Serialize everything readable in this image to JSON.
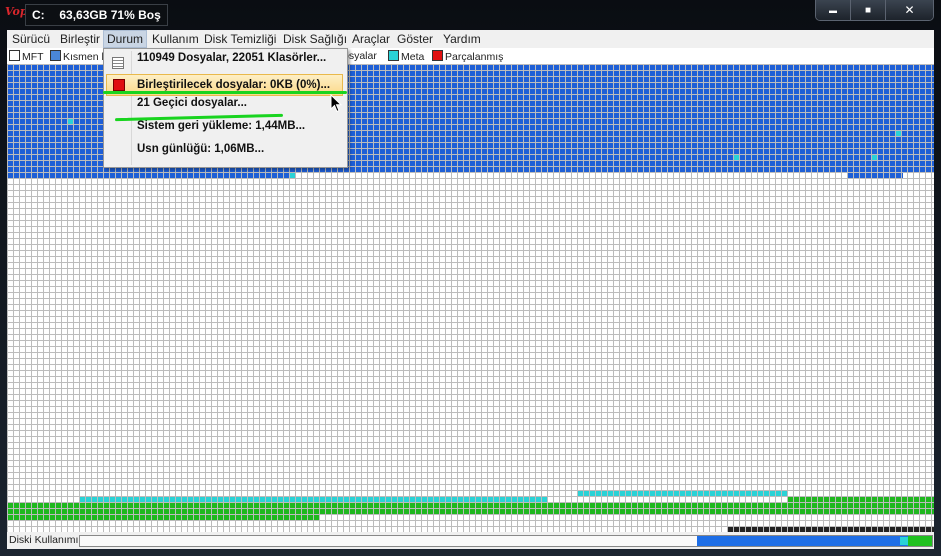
{
  "titlebar": {
    "logo": "Vopt",
    "drive": "C:",
    "summary": "63,63GB 71% Boş"
  },
  "window_controls": {
    "minimize": "▬",
    "maximize": "■",
    "close": "✕"
  },
  "menu": [
    "Sürücü",
    "Birleştir",
    "Durum",
    "Kullanım",
    "Disk Temizliği",
    "Disk Sağlığı",
    "Araçlar",
    "Göster",
    "Yardım"
  ],
  "legend": [
    {
      "label": "MFT",
      "color": "#ffffff"
    },
    {
      "label": "Kısmen b",
      "color": "#4a86d8"
    },
    {
      "label": "osyalar",
      "color": ""
    },
    {
      "label": "Meta",
      "color": "#2ad2d6"
    },
    {
      "label": "Parçalanmış",
      "color": "#e01010"
    }
  ],
  "dropdown": {
    "items": [
      {
        "label": "110949 Dosyalar, 22051 Klasörler...",
        "icon": "list-icon"
      },
      {
        "label": "Birleştirilecek dosyalar: 0KB (0%)...",
        "icon": "red-square-icon"
      },
      {
        "label": "21 Geçici dosyalar...",
        "icon": ""
      },
      {
        "label": "Sistem geri yükleme: 1,44MB...",
        "icon": ""
      },
      {
        "label": "Usn günlüğü: 1,06MB...",
        "icon": ""
      }
    ]
  },
  "status": {
    "label": "Diski Kullanımı:"
  },
  "colors": {
    "used": "#1e5fd6",
    "meta": "#2ad2d6",
    "green": "#1fb81f",
    "free": "#ffffff",
    "grid": "#bcbcbc",
    "dark": "#222222",
    "highlight": "#fbd98a",
    "annotation": "#19d41f"
  }
}
